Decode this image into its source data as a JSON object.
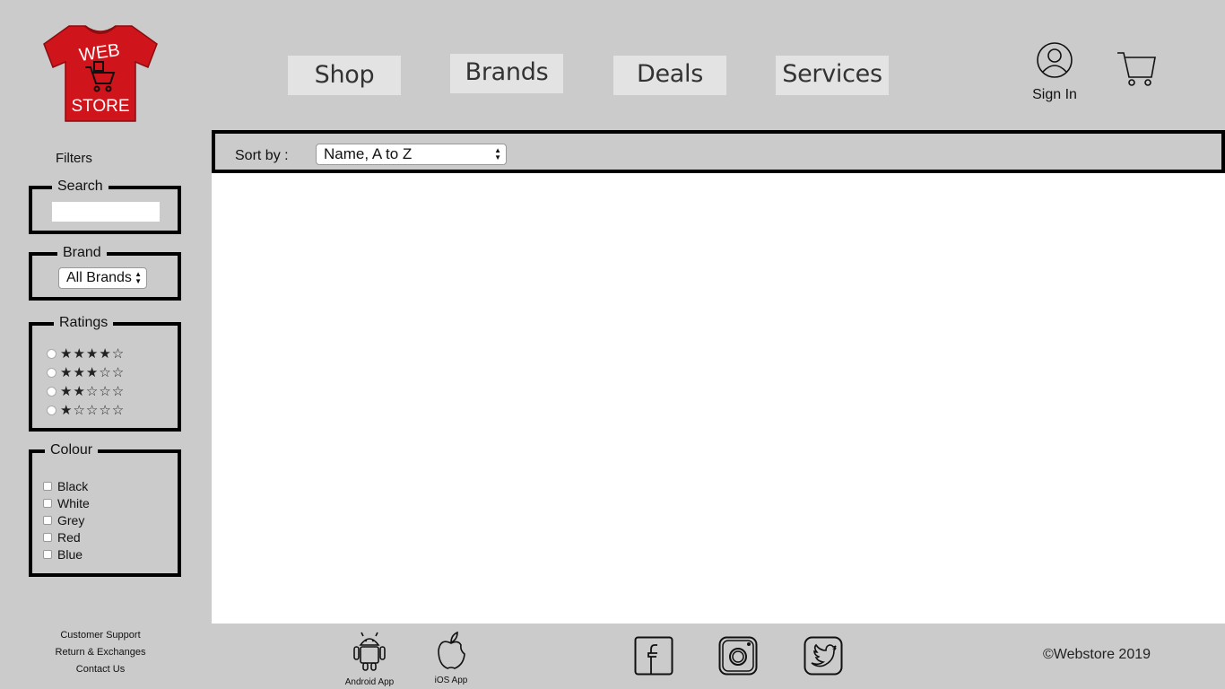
{
  "brand": {
    "logo_top": "WEB",
    "logo_bottom": "STORE",
    "logo_color": "#d0141b"
  },
  "nav": {
    "items": [
      {
        "label": "Shop"
      },
      {
        "label": "Brands"
      },
      {
        "label": "Deals"
      },
      {
        "label": "Services"
      }
    ],
    "sign_in": "Sign In",
    "cart_icon": "cart-icon"
  },
  "sidebar": {
    "title": "Filters",
    "search": {
      "legend": "Search",
      "value": "",
      "placeholder": ""
    },
    "brand": {
      "legend": "Brand",
      "selected": "All Brands"
    },
    "ratings": {
      "legend": "Ratings",
      "options": [
        "★★★★☆",
        "★★★☆☆",
        "★★☆☆☆",
        "★☆☆☆☆"
      ]
    },
    "colour": {
      "legend": "Colour",
      "options": [
        "Black",
        "White",
        "Grey",
        "Red",
        "Blue"
      ]
    }
  },
  "main": {
    "sort_label": "Sort by :",
    "sort_selected": "Name, A to Z"
  },
  "footer": {
    "links": [
      "Customer Support",
      "Return & Exchanges",
      "Contact Us"
    ],
    "apps": [
      {
        "label": "Android App",
        "icon": "android-icon"
      },
      {
        "label": "iOS App",
        "icon": "apple-icon"
      }
    ],
    "social": [
      "facebook-icon",
      "instagram-icon",
      "twitter-icon"
    ],
    "copyright": "©Webstore 2019"
  }
}
